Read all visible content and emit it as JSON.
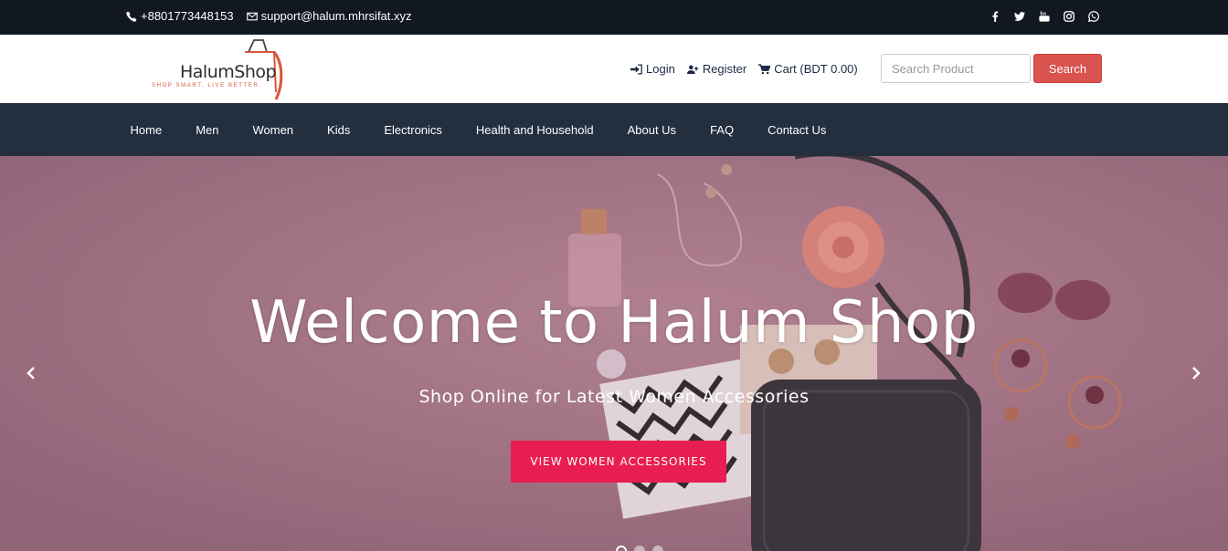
{
  "topbar": {
    "phone": "+8801773448153",
    "email": "support@halum.mhrsifat.xyz",
    "social": [
      "facebook-icon",
      "twitter-icon",
      "youtube-icon",
      "instagram-icon",
      "whatsapp-icon"
    ]
  },
  "header": {
    "logo_name": "HalumShop",
    "logo_tagline": "SHOP SMART. LIVE BETTER.",
    "login": "Login",
    "register": "Register",
    "cart": "Cart (BDT 0.00)",
    "search_placeholder": "Search Product",
    "search_button": "Search"
  },
  "nav": {
    "items": [
      "Home",
      "Men",
      "Women",
      "Kids",
      "Electronics",
      "Health and Household",
      "About Us",
      "FAQ",
      "Contact Us"
    ]
  },
  "hero": {
    "title": "Welcome to Halum Shop",
    "subtitle": "Shop Online for Latest Women Accessories",
    "cta": "VIEW WOMEN ACCESSORIES",
    "slides": 3,
    "active_slide": 1
  },
  "colors": {
    "topbar_bg": "#121821",
    "nav_bg": "#232f3e",
    "search_button": "#d9534f",
    "cta": "#e91e50",
    "hero_bg": "#a27787"
  }
}
